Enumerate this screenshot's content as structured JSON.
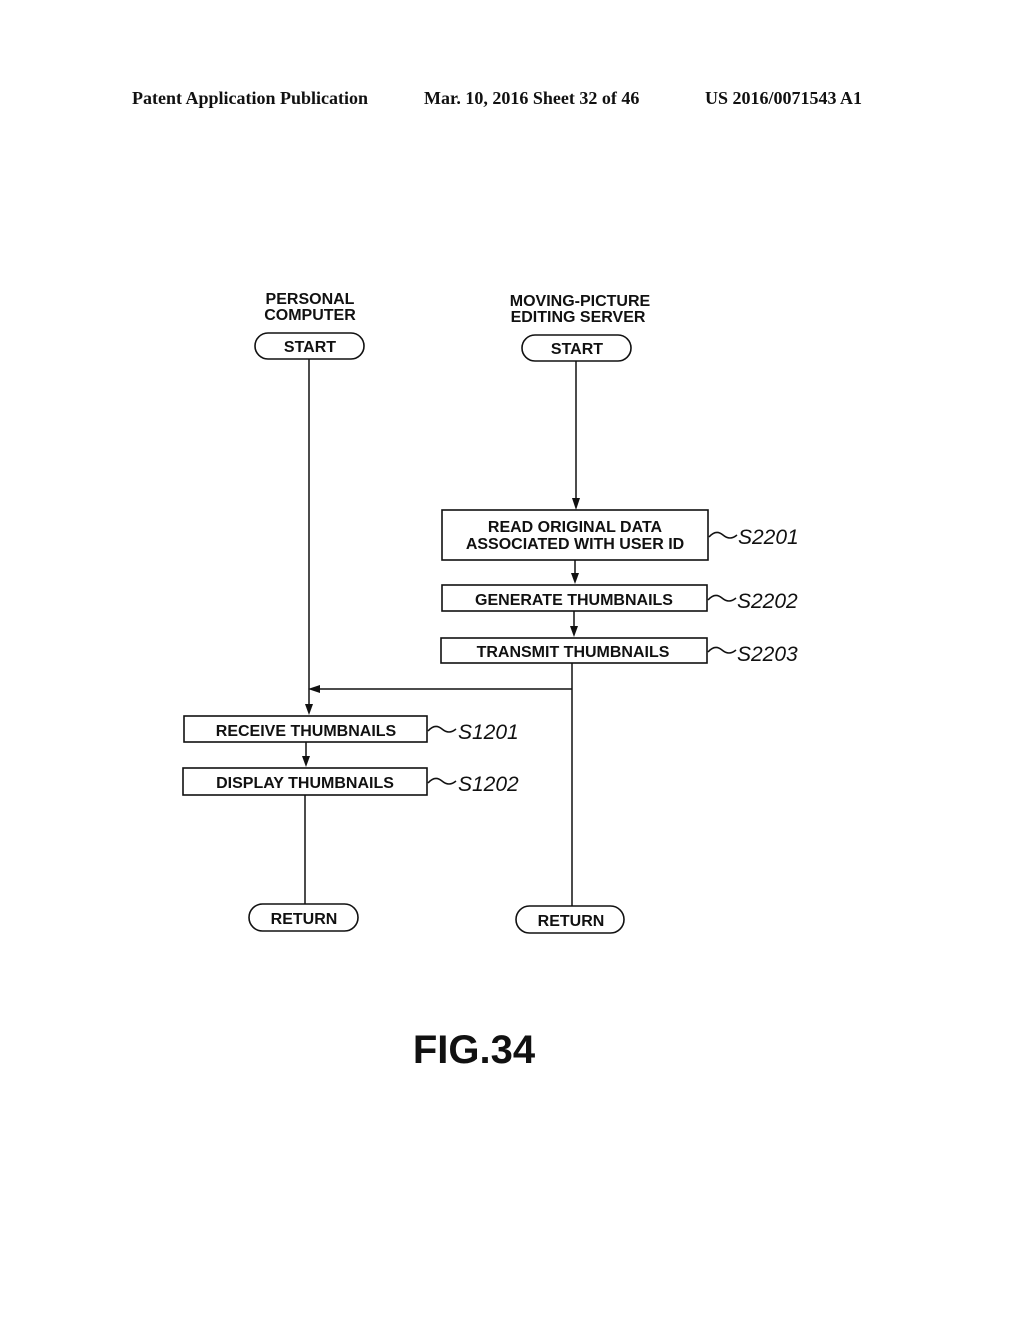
{
  "header": {
    "publication": "Patent Application Publication",
    "date_sheet": "Mar. 10, 2016  Sheet 32 of 46",
    "number": "US 2016/0071543 A1"
  },
  "lanes": {
    "left": {
      "title_line1": "PERSONAL",
      "title_line2": "COMPUTER",
      "start": "START",
      "end": "RETURN"
    },
    "right": {
      "title_line1": "MOVING-PICTURE",
      "title_line2": "EDITING SERVER",
      "start": "START",
      "end": "RETURN"
    }
  },
  "steps": {
    "s2201": {
      "line1": "READ ORIGINAL DATA",
      "line2": "ASSOCIATED WITH USER ID",
      "label": "S2201"
    },
    "s2202": {
      "text": "GENERATE THUMBNAILS",
      "label": "S2202"
    },
    "s2203": {
      "text": "TRANSMIT THUMBNAILS",
      "label": "S2203"
    },
    "s1201": {
      "text": "RECEIVE THUMBNAILS",
      "label": "S1201"
    },
    "s1202": {
      "text": "DISPLAY THUMBNAILS",
      "label": "S1202"
    }
  },
  "figure": {
    "caption": "FIG.34"
  }
}
